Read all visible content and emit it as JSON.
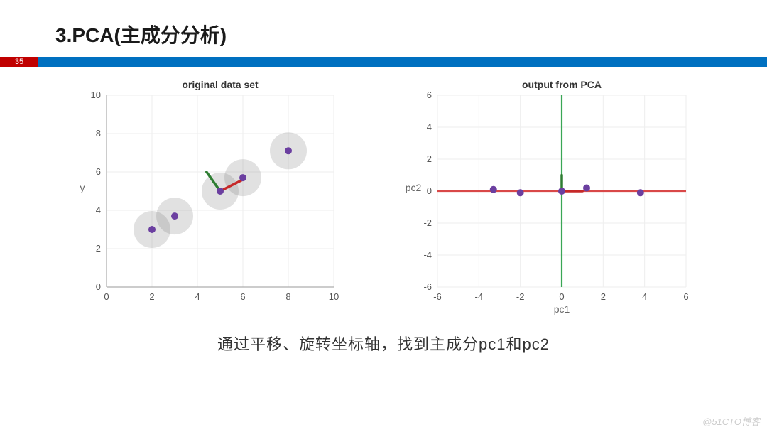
{
  "slide": {
    "title": "3.PCA(主成分分析)",
    "page_number": "35",
    "caption": "通过平移、旋转坐标轴，找到主成分pc1和pc2",
    "watermark": "@51CTO博客"
  },
  "chart_data": [
    {
      "type": "scatter",
      "title": "original data set",
      "xlabel": "",
      "ylabel": "y",
      "xlim": [
        0,
        10
      ],
      "ylim": [
        0,
        10
      ],
      "xticks": [
        0,
        2,
        4,
        6,
        8,
        10
      ],
      "yticks": [
        0,
        2,
        4,
        6,
        8,
        10
      ],
      "series": [
        {
          "name": "points",
          "color": "#6b3fa0",
          "data": [
            {
              "x": 2.0,
              "y": 3.0
            },
            {
              "x": 3.0,
              "y": 3.7
            },
            {
              "x": 5.0,
              "y": 5.0
            },
            {
              "x": 6.0,
              "y": 5.7
            },
            {
              "x": 8.0,
              "y": 7.1
            }
          ]
        },
        {
          "name": "halo",
          "color": "rgba(120,120,120,0.22)"
        }
      ],
      "arrows": [
        {
          "from": [
            5,
            5
          ],
          "to": [
            6,
            5.6
          ],
          "color": "#c62828"
        },
        {
          "from": [
            5,
            5
          ],
          "to": [
            4.4,
            6.0
          ],
          "color": "#2e7d32"
        }
      ]
    },
    {
      "type": "scatter",
      "title": "output from PCA",
      "xlabel": "pc1",
      "ylabel": "pc2",
      "xlim": [
        -6,
        6
      ],
      "ylim": [
        -6,
        6
      ],
      "xticks": [
        -6,
        -4,
        -2,
        0,
        2,
        4,
        6
      ],
      "yticks": [
        -6,
        -4,
        -2,
        0,
        2,
        4,
        6
      ],
      "xlabel_color": "#d94848",
      "ylabel_color": "#3aa655",
      "xaxis_color": "#d94848",
      "yaxis_color": "#3aa655",
      "series": [
        {
          "name": "points",
          "color": "#6b3fa0",
          "data": [
            {
              "x": -3.3,
              "y": 0.1
            },
            {
              "x": -2.0,
              "y": -0.1
            },
            {
              "x": 0.0,
              "y": 0.0
            },
            {
              "x": 1.2,
              "y": 0.2
            },
            {
              "x": 3.8,
              "y": -0.1
            }
          ]
        }
      ],
      "arrows": [
        {
          "from": [
            0,
            0
          ],
          "to": [
            1.0,
            0
          ],
          "color": "#c62828"
        },
        {
          "from": [
            0,
            0
          ],
          "to": [
            0,
            1.0
          ],
          "color": "#2e7d32"
        }
      ]
    }
  ]
}
